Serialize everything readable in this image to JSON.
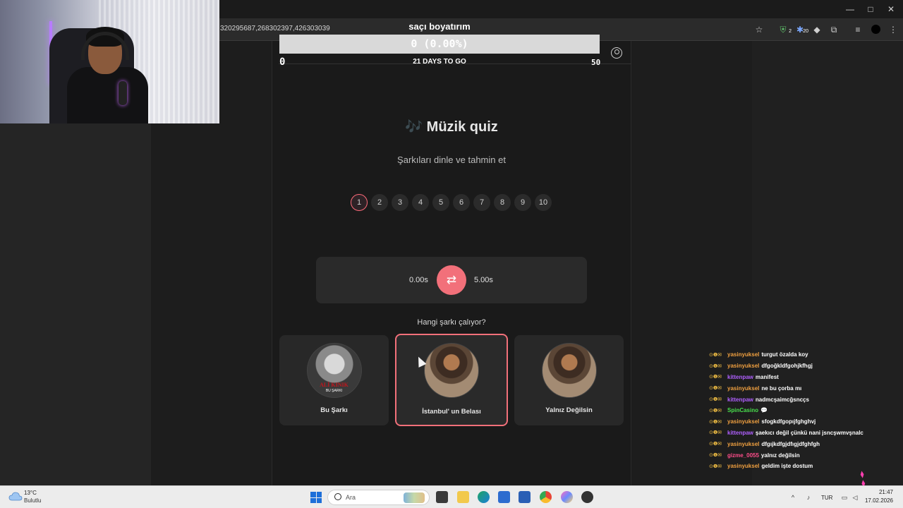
{
  "browser": {
    "url": "320295687,268302397,426303039",
    "window_controls": {
      "minimize": "—",
      "maximize": "□",
      "close": "✕"
    },
    "extension_badges": [
      "2",
      "20"
    ]
  },
  "goal": {
    "title": "saçı boyatırım",
    "value_text": "0 (0.00%)",
    "progress_fraction": 0.0,
    "min": "0",
    "max": "50",
    "days_left": "21 DAYS TO GO",
    "colors": {
      "bar_bg": "#d9d9d9",
      "fill": "#ff5f6d"
    }
  },
  "quiz": {
    "icon": "🎶",
    "title": "Müzik quiz",
    "subtitle": "Şarkıları dinle ve tahmin et",
    "pages": [
      "1",
      "2",
      "3",
      "4",
      "5",
      "6",
      "7",
      "8",
      "9",
      "10"
    ],
    "active_page": "1",
    "player": {
      "start_time": "0.00s",
      "end_time": "5.00s",
      "repeat_icon": "⇄"
    },
    "question": "Hangi şarkı çalıyor?",
    "options": [
      {
        "label": "Bu Şarkı",
        "art_text": "ALİ KINIK",
        "art_subtext": "BU ŞARKI",
        "selected": false
      },
      {
        "label": "İstanbul' un Belası",
        "selected": true
      },
      {
        "label": "Yalnız Değilsin",
        "selected": false
      }
    ],
    "accent_color": "#f2707a"
  },
  "chat": [
    {
      "user": "yasinyuksel",
      "color": "#f0a040",
      "message": "turgut özalda koy"
    },
    {
      "user": "yasinyuksel",
      "color": "#f0a040",
      "message": "dfgoğkldfgohjkfhgj"
    },
    {
      "user": "kittenpaw",
      "color": "#b060ff",
      "message": "manifest"
    },
    {
      "user": "yasinyuksel",
      "color": "#f0a040",
      "message": "ne bu çorba mı"
    },
    {
      "user": "kittenpaw",
      "color": "#b060ff",
      "message": "nadmcşaimcğsncçs"
    },
    {
      "user": "SpinCasino",
      "color": "#49e04d",
      "message": "💬"
    },
    {
      "user": "yasinyuksel",
      "color": "#f0a040",
      "message": "sfogkdfgopıjfghghvj"
    },
    {
      "user": "kittenpaw",
      "color": "#b060ff",
      "message": "şaekıcı değil çünkü nani jsncşwmvşnalc"
    },
    {
      "user": "yasinyuksel",
      "color": "#f0a040",
      "message": "dfgıjkdfgjdfıgjdfghfgh"
    },
    {
      "user": "gizme_0055",
      "color": "#ff4d8a",
      "message": "yalnız değilsin"
    },
    {
      "user": "yasinyuksel",
      "color": "#f0a040",
      "message": "geldim işte dostum"
    }
  ],
  "taskbar": {
    "weather_temp": "13°C",
    "weather_desc": "Bulutlu",
    "search_placeholder": "Ara",
    "language": "TUR",
    "time": "21:47",
    "date": "17.02.2026"
  }
}
